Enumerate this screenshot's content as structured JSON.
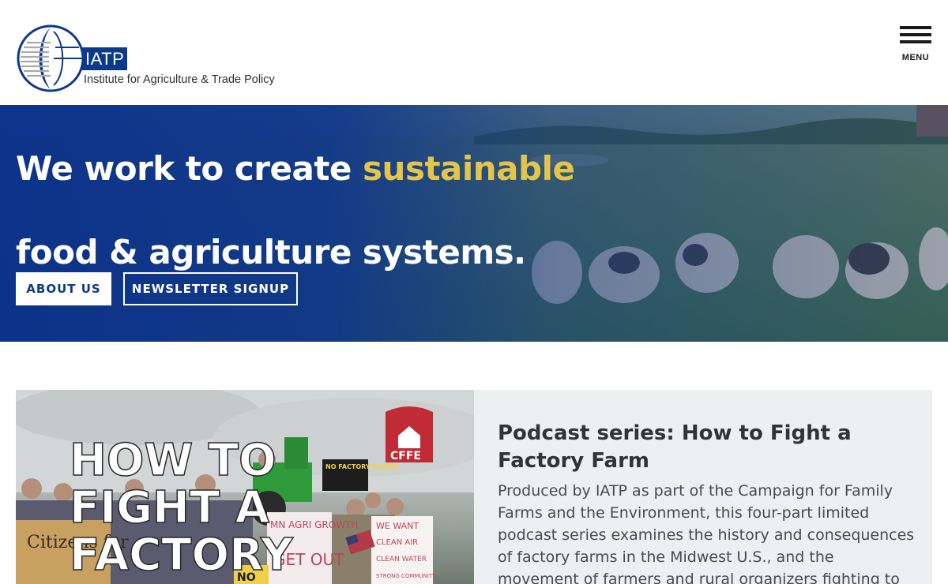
{
  "header": {
    "logo_abbr": "IATP",
    "logo_full_name": "Institute for Agriculture & Trade Policy",
    "menu_label": "MENU"
  },
  "hero": {
    "title_part1": "We work to create ",
    "title_highlight": "sustainable",
    "title_part2": "food & agriculture systems.",
    "buttons": {
      "about": "ABOUT US",
      "newsletter": "NEWSLETTER SIGNUP"
    }
  },
  "feature": {
    "image": {
      "headline_lines": [
        "HOW TO",
        "FIGHT A",
        "FACTORY"
      ],
      "badge": "CFFE",
      "signs": {
        "no_factory_farms": "NO FACTORY FARMS!",
        "we_want": "WE WANT",
        "clean_air": "CLEAN AIR",
        "clean_water": "CLEAN WATER",
        "strong_community": "STRONG COMMUNITY",
        "mn_agri_growth": "MN AGRI GROWTH",
        "get_out": "GET OUT",
        "citizens": "Citizens for",
        "no": "NO"
      }
    },
    "title": "Podcast series: How to Fight a Factory Farm",
    "body": "Produced by IATP as part of the Campaign for Family Farms and the Environment, this four-part limited podcast series examines the history and consequences of factory farms in the Midwest U.S., and the movement of farmers and rural organizers fighting to stop them."
  },
  "colors": {
    "brand_blue": "#0b3a8c",
    "highlight_yellow": "#e4c54b",
    "feature_bg": "#eeeff1"
  }
}
